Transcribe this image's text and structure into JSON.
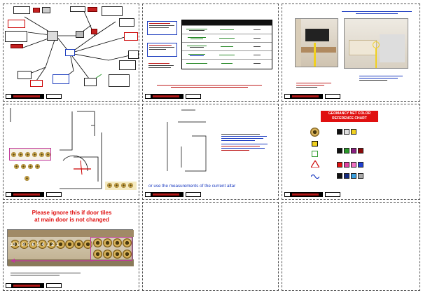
{
  "sheet_nine": {
    "warning_line1": "Please ignore this if door tiles",
    "warning_line2": "at main door is not changed",
    "numbers": [
      "10",
      "9",
      "8",
      "7",
      "6",
      "5",
      "4",
      "3",
      "2",
      "1"
    ]
  },
  "sheet_five": {
    "footer": "or use the measurements of the current altar"
  },
  "sheet_six": {
    "title_line1": "GEOMANCY NET COLOR",
    "title_line2": "REFERENCE CHART"
  },
  "colors": {
    "accent_red": "#e01010",
    "link_blue": "#1a3ac0",
    "title_bar": "#b01818"
  }
}
